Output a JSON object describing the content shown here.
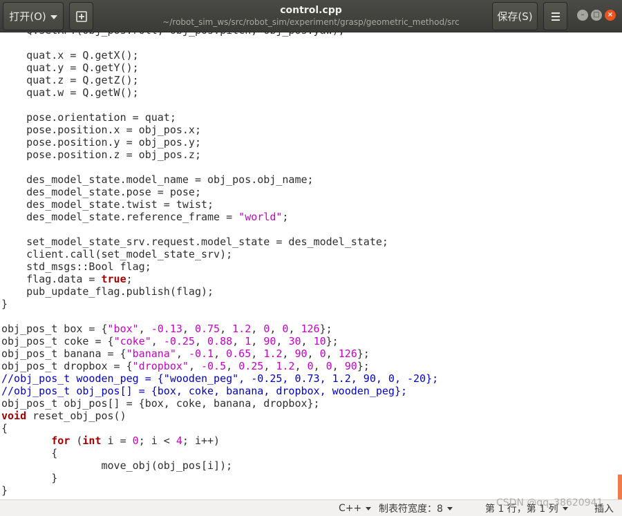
{
  "header": {
    "open_label": "打开(O)",
    "save_label": "保存(S)",
    "title": "control.cpp",
    "path": "~/robot_sim_ws/src/robot_sim/experiment/grasp/geometric_method/src"
  },
  "window_controls": {
    "minimize_glyph": "–",
    "maximize_glyph": "□",
    "close_glyph": "×"
  },
  "code_lines": [
    [
      {
        "t": "    Q.setRPY(obj_pos.roll, obj_pos.pitch, obj_pos.yaw);",
        "c": ""
      }
    ],
    [
      {
        "t": "",
        "c": ""
      }
    ],
    [
      {
        "t": "    quat.x = Q.getX();",
        "c": ""
      }
    ],
    [
      {
        "t": "    quat.y = Q.getY();",
        "c": ""
      }
    ],
    [
      {
        "t": "    quat.z = Q.getZ();",
        "c": ""
      }
    ],
    [
      {
        "t": "    quat.w = Q.getW();",
        "c": ""
      }
    ],
    [
      {
        "t": "",
        "c": ""
      }
    ],
    [
      {
        "t": "    pose.orientation = quat;",
        "c": ""
      }
    ],
    [
      {
        "t": "    pose.position.x = obj_pos.x;",
        "c": ""
      }
    ],
    [
      {
        "t": "    pose.position.y = obj_pos.y;",
        "c": ""
      }
    ],
    [
      {
        "t": "    pose.position.z = obj_pos.z;",
        "c": ""
      }
    ],
    [
      {
        "t": "",
        "c": ""
      }
    ],
    [
      {
        "t": "    des_model_state.model_name = obj_pos.obj_name;",
        "c": ""
      }
    ],
    [
      {
        "t": "    des_model_state.pose = pose;",
        "c": ""
      }
    ],
    [
      {
        "t": "    des_model_state.twist = twist;",
        "c": ""
      }
    ],
    [
      {
        "t": "    des_model_state.reference_frame = ",
        "c": ""
      },
      {
        "t": "\"world\"",
        "c": "str"
      },
      {
        "t": ";",
        "c": ""
      }
    ],
    [
      {
        "t": "",
        "c": ""
      }
    ],
    [
      {
        "t": "    set_model_state_srv.request.model_state = des_model_state;",
        "c": ""
      }
    ],
    [
      {
        "t": "    client.call(set_model_state_srv);",
        "c": ""
      }
    ],
    [
      {
        "t": "    std_msgs::Bool flag;",
        "c": ""
      }
    ],
    [
      {
        "t": "    flag.data = ",
        "c": ""
      },
      {
        "t": "true",
        "c": "kw"
      },
      {
        "t": ";",
        "c": ""
      }
    ],
    [
      {
        "t": "    pub_update_flag.publish(flag);",
        "c": ""
      }
    ],
    [
      {
        "t": "}",
        "c": ""
      }
    ],
    [
      {
        "t": "",
        "c": ""
      }
    ],
    [
      {
        "t": "obj_pos_t box = {",
        "c": ""
      },
      {
        "t": "\"box\"",
        "c": "str"
      },
      {
        "t": ", ",
        "c": ""
      },
      {
        "t": "-0.13",
        "c": "num"
      },
      {
        "t": ", ",
        "c": ""
      },
      {
        "t": "0.75",
        "c": "num"
      },
      {
        "t": ", ",
        "c": ""
      },
      {
        "t": "1.2",
        "c": "num"
      },
      {
        "t": ", ",
        "c": ""
      },
      {
        "t": "0",
        "c": "num"
      },
      {
        "t": ", ",
        "c": ""
      },
      {
        "t": "0",
        "c": "num"
      },
      {
        "t": ", ",
        "c": ""
      },
      {
        "t": "126",
        "c": "num"
      },
      {
        "t": "};",
        "c": ""
      }
    ],
    [
      {
        "t": "obj_pos_t coke = {",
        "c": ""
      },
      {
        "t": "\"coke\"",
        "c": "str"
      },
      {
        "t": ", ",
        "c": ""
      },
      {
        "t": "-0.25",
        "c": "num"
      },
      {
        "t": ", ",
        "c": ""
      },
      {
        "t": "0.88",
        "c": "num"
      },
      {
        "t": ", ",
        "c": ""
      },
      {
        "t": "1",
        "c": "num"
      },
      {
        "t": ", ",
        "c": ""
      },
      {
        "t": "90",
        "c": "num"
      },
      {
        "t": ", ",
        "c": ""
      },
      {
        "t": "30",
        "c": "num"
      },
      {
        "t": ", ",
        "c": ""
      },
      {
        "t": "10",
        "c": "num"
      },
      {
        "t": "};",
        "c": ""
      }
    ],
    [
      {
        "t": "obj_pos_t banana = {",
        "c": ""
      },
      {
        "t": "\"banana\"",
        "c": "str"
      },
      {
        "t": ", ",
        "c": ""
      },
      {
        "t": "-0.1",
        "c": "num"
      },
      {
        "t": ", ",
        "c": ""
      },
      {
        "t": "0.65",
        "c": "num"
      },
      {
        "t": ", ",
        "c": ""
      },
      {
        "t": "1.2",
        "c": "num"
      },
      {
        "t": ", ",
        "c": ""
      },
      {
        "t": "90",
        "c": "num"
      },
      {
        "t": ", ",
        "c": ""
      },
      {
        "t": "0",
        "c": "num"
      },
      {
        "t": ", ",
        "c": ""
      },
      {
        "t": "126",
        "c": "num"
      },
      {
        "t": "};",
        "c": ""
      }
    ],
    [
      {
        "t": "obj_pos_t dropbox = {",
        "c": ""
      },
      {
        "t": "\"dropbox\"",
        "c": "str"
      },
      {
        "t": ", ",
        "c": ""
      },
      {
        "t": "-0.5",
        "c": "num"
      },
      {
        "t": ", ",
        "c": ""
      },
      {
        "t": "0.25",
        "c": "num"
      },
      {
        "t": ", ",
        "c": ""
      },
      {
        "t": "1.2",
        "c": "num"
      },
      {
        "t": ", ",
        "c": ""
      },
      {
        "t": "0",
        "c": "num"
      },
      {
        "t": ", ",
        "c": ""
      },
      {
        "t": "0",
        "c": "num"
      },
      {
        "t": ", ",
        "c": ""
      },
      {
        "t": "90",
        "c": "num"
      },
      {
        "t": "};",
        "c": ""
      }
    ],
    [
      {
        "t": "//obj_pos_t wooden_peg = {\"wooden_peg\", -0.25, 0.73, 1.2, 90, 0, -20};",
        "c": "cmt"
      }
    ],
    [
      {
        "t": "//obj_pos_t obj_pos[] = {box, coke, banana, dropbox, wooden_peg};",
        "c": "cmt"
      }
    ],
    [
      {
        "t": "obj_pos_t obj_pos[] = {box, coke, banana, dropbox};",
        "c": ""
      }
    ],
    [
      {
        "t": "void",
        "c": "kw"
      },
      {
        "t": " reset_obj_pos()",
        "c": ""
      }
    ],
    [
      {
        "t": "{",
        "c": ""
      }
    ],
    [
      {
        "t": "        ",
        "c": ""
      },
      {
        "t": "for",
        "c": "kw"
      },
      {
        "t": " (",
        "c": ""
      },
      {
        "t": "int",
        "c": "kw"
      },
      {
        "t": " i = ",
        "c": ""
      },
      {
        "t": "0",
        "c": "num"
      },
      {
        "t": "; i < ",
        "c": ""
      },
      {
        "t": "4",
        "c": "num"
      },
      {
        "t": "; i++)",
        "c": ""
      }
    ],
    [
      {
        "t": "        {",
        "c": ""
      }
    ],
    [
      {
        "t": "                move_obj(obj_pos[i]);",
        "c": ""
      }
    ],
    [
      {
        "t": "        }",
        "c": ""
      }
    ],
    [
      {
        "t": "}",
        "c": ""
      }
    ]
  ],
  "statusbar": {
    "language": "C++",
    "tab_width": "制表符宽度：8",
    "position": "第 1 行，第 1 列",
    "mode": "插入"
  },
  "watermark": "CSDN @qq_38620941",
  "colors": {
    "header_bg": "#3c3b37",
    "keyword": "#a40000",
    "string": "#c800c8",
    "comment": "#0000c8",
    "close_button": "#e95420",
    "scroll_thumb": "#ef7a4a"
  }
}
